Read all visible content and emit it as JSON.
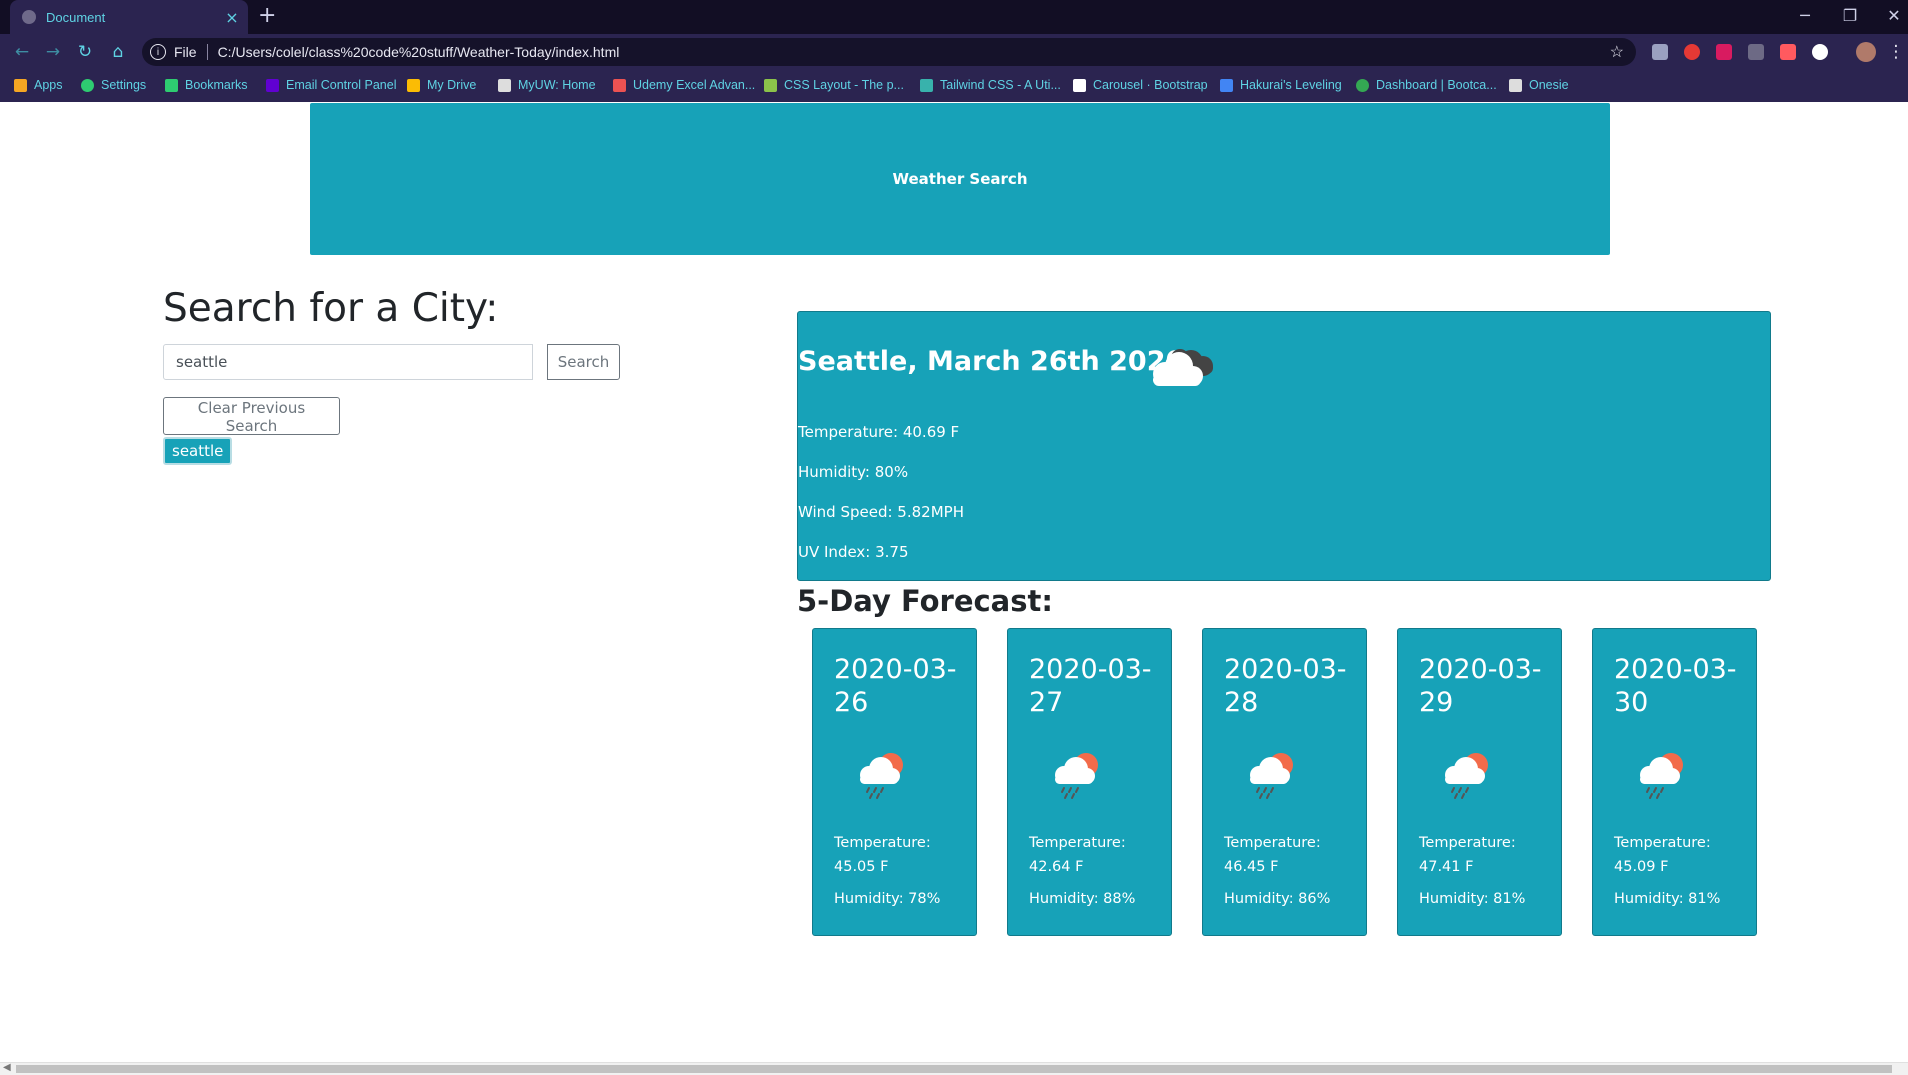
{
  "browser": {
    "tab_title": "Document",
    "tab_close": "×",
    "new_tab": "+",
    "window_controls": [
      "─",
      "❐",
      "✕"
    ],
    "omnibox_info": "i",
    "scheme_label": "File",
    "url": "C:/Users/colel/class%20code%20stuff/Weather-Today/index.html",
    "star": "☆",
    "bookmarks": [
      {
        "label": "Apps",
        "color": "#f5a623"
      },
      {
        "label": "Settings",
        "color": "#2ecc71"
      },
      {
        "label": "Bookmarks",
        "color": "#2ecc71"
      },
      {
        "label": "Email Control Panel",
        "color": "#6001d2"
      },
      {
        "label": "My Drive",
        "color": "#fbbc04"
      },
      {
        "label": "MyUW: Home",
        "color": "#dddddd"
      },
      {
        "label": "Udemy Excel Advan...",
        "color": "#ec5252"
      },
      {
        "label": "CSS Layout - The p...",
        "color": "#8bc34a"
      },
      {
        "label": "Tailwind CSS - A Uti...",
        "color": "#38b2ac"
      },
      {
        "label": "Carousel · Bootstrap",
        "color": "#ffffff"
      },
      {
        "label": "Hakurai's Leveling",
        "color": "#4285f4"
      },
      {
        "label": "Dashboard | Bootca...",
        "color": "#34a853"
      },
      {
        "label": "Onesie",
        "color": "#dddddd"
      }
    ]
  },
  "header": {
    "title": "Weather Search"
  },
  "search": {
    "heading": "Search for a City:",
    "input_value": "seattle",
    "button_label": "Search",
    "clear_label": "Clear Previous Search",
    "history": [
      "seattle"
    ]
  },
  "current": {
    "heading": "Seattle, March 26th 2020",
    "icon": "broken-clouds-icon",
    "temperature": "Temperature: 40.69 F",
    "humidity": "Humidity: 80%",
    "wind": "Wind Speed: 5.82MPH",
    "uv": "UV Index: 3.75"
  },
  "forecast": {
    "heading": "5-Day Forecast:",
    "days": [
      {
        "date": "2020-03-26",
        "icon": "rain-sun-icon",
        "temp_label": "Temperature:",
        "temp": "45.05 F",
        "humidity": "Humidity: 78%"
      },
      {
        "date": "2020-03-27",
        "icon": "rain-sun-icon",
        "temp_label": "Temperature:",
        "temp": "42.64 F",
        "humidity": "Humidity: 88%"
      },
      {
        "date": "2020-03-28",
        "icon": "rain-sun-icon",
        "temp_label": "Temperature:",
        "temp": "46.45 F",
        "humidity": "Humidity: 86%"
      },
      {
        "date": "2020-03-29",
        "icon": "rain-sun-icon",
        "temp_label": "Temperature:",
        "temp": "47.41 F",
        "humidity": "Humidity: 81%"
      },
      {
        "date": "2020-03-30",
        "icon": "rain-sun-icon",
        "temp_label": "Temperature:",
        "temp": "45.09 F",
        "humidity": "Humidity: 81%"
      }
    ]
  },
  "colors": {
    "accent": "#17a2b8",
    "chrome": "#2b2450",
    "tabstrip": "#120e24"
  }
}
